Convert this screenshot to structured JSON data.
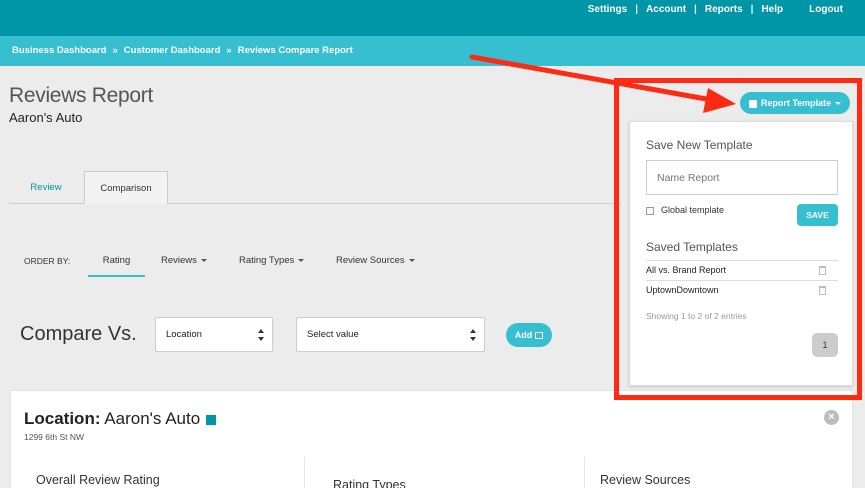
{
  "topnav": {
    "items": [
      "Settings",
      "Account",
      "Reports",
      "Help"
    ],
    "separator": "|",
    "logout": "Logout"
  },
  "breadcrumb": {
    "items": [
      "Business Dashboard",
      "Customer Dashboard",
      "Reviews Compare Report"
    ],
    "separator": "»"
  },
  "page": {
    "title": "Reviews Report",
    "subtitle": "Aaron's Auto"
  },
  "tabs": [
    {
      "label": "Review",
      "active": false
    },
    {
      "label": "Comparison",
      "active": true
    }
  ],
  "order_by": {
    "label": "ORDER BY:",
    "items": [
      "Rating",
      "Reviews",
      "Rating Types",
      "Review Sources"
    ],
    "active": "Rating"
  },
  "compare": {
    "label": "Compare Vs.",
    "location_select": "Location",
    "value_select": "Select value",
    "add_label": "Add"
  },
  "location_card": {
    "label": "Location:",
    "name": "Aaron's Auto",
    "address": "1299 6th St NW",
    "swatch_color": "#0095a7",
    "columns": [
      "Overall Review Rating",
      "Rating Types",
      "Review Sources"
    ]
  },
  "report_template": {
    "button_label": "Report Template",
    "save_heading": "Save New Template",
    "name_placeholder": "Name Report",
    "global_label": "Global template",
    "save_label": "SAVE",
    "saved_heading": "Saved Templates",
    "saved": [
      "All vs. Brand Report",
      "UptownDowntown"
    ],
    "showing": "Showing 1 to 2 of 2 entries",
    "page": "1"
  },
  "colors": {
    "primary": "#0095a7",
    "accent": "#35bfd0",
    "highlight": "#ff2a14"
  }
}
